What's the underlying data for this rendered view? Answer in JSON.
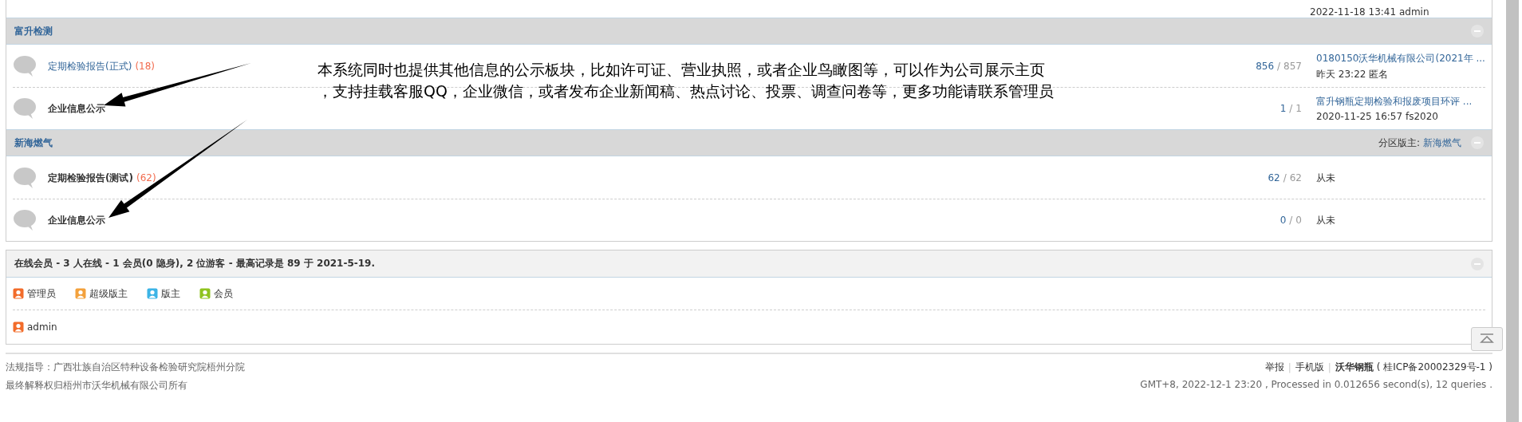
{
  "top_row": {
    "last_post_meta": "2022-11-18 13:41 admin"
  },
  "categories": [
    {
      "title": "富升检测",
      "forums": [
        {
          "name": "定期检验报告(正式)",
          "unread": false,
          "today": "(18)",
          "threads": "856",
          "separator": "/",
          "posts": "857",
          "last_post": {
            "title": "0180150沃华机械有限公司(2021年 ...",
            "meta": "昨天 23:22 匿名"
          }
        },
        {
          "name": "企业信息公示",
          "unread": true,
          "threads": "1",
          "separator": "/",
          "posts": "1",
          "last_post": {
            "title": "富升钢瓶定期检验和报废项目环评 ...",
            "meta": "2020-11-25 16:57 fs2020"
          }
        }
      ]
    },
    {
      "title": "新海燃气",
      "moderator_label": "分区版主:",
      "moderator": "新海燃气",
      "forums": [
        {
          "name": "定期检验报告(测试)",
          "unread": true,
          "today": "(62)",
          "threads": "62",
          "separator": "/",
          "posts": "62",
          "last_post": {
            "never": "从未"
          }
        },
        {
          "name": "企业信息公示",
          "unread": true,
          "threads": "0",
          "separator": "/",
          "posts": "0",
          "last_post": {
            "never": "从未"
          }
        }
      ]
    }
  ],
  "annotation": {
    "lines": [
      "本系统同时也提供其他信息的公示板块，比如许可证、营业执照，或者企业鸟瞰图等，可以作为公司展示主页",
      "，支持挂载客服QQ，企业微信，或者发布企业新闻稿、热点讨论、投票、调查问卷等，更多功能请联系管理员"
    ]
  },
  "online": {
    "title": "在线会员 - 3 人在线 - 1 会员(0 隐身), 2 位游客 - 最高记录是 89 于 2021-5-19.",
    "legend": [
      {
        "label": "管理员",
        "color": "#f26c2b"
      },
      {
        "label": "超级版主",
        "color": "#f3a13c"
      },
      {
        "label": "版主",
        "color": "#3cb4e6"
      },
      {
        "label": "会员",
        "color": "#8fc31f"
      }
    ],
    "users": [
      {
        "name": "admin",
        "color": "#f26c2b"
      }
    ]
  },
  "footer": {
    "left": [
      "法规指导：广西壮族自治区特种设备检验研究院梧州分院",
      "最终解释权归梧州市沃华机械有限公司所有"
    ],
    "links": [
      {
        "label": "举报",
        "bold": false
      },
      {
        "label": "手机版",
        "bold": false
      },
      {
        "label": "沃华钢瓶",
        "bold": true
      }
    ],
    "separators": [
      "|",
      "|"
    ],
    "icp": "( 桂ICP备20002329号-1 )",
    "stats": "GMT+8, 2022-12-1 23:20 , Processed in 0.012656 second(s), 12 queries ."
  }
}
